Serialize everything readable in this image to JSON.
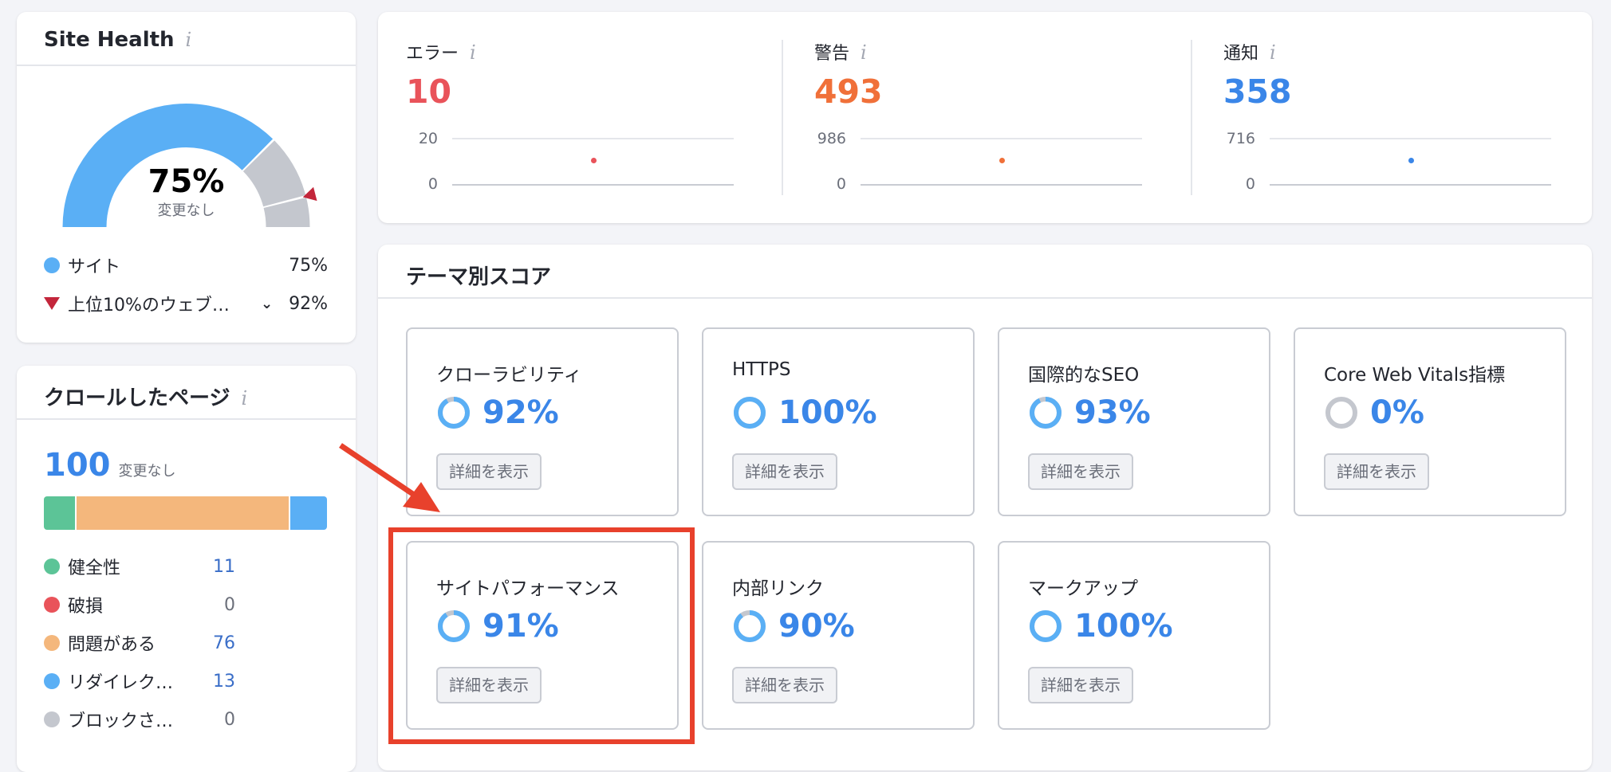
{
  "site_health": {
    "title": "Site Health",
    "value": "75%",
    "change": "変更なし",
    "gauge_percent": 75,
    "top10_percent": 92,
    "legend": [
      {
        "label": "サイト",
        "value": "75%",
        "color": "#5aaff5"
      },
      {
        "label": "上位10%のウェブ…",
        "value": "92%",
        "color": "#c3263b"
      }
    ]
  },
  "crawled": {
    "title": "クロールしたページ",
    "total": "100",
    "change": "変更なし",
    "items": [
      {
        "label": "健全性",
        "value": "11",
        "color": "#5cc497"
      },
      {
        "label": "破損",
        "value": "0",
        "color": "#e9535a"
      },
      {
        "label": "問題がある",
        "value": "76",
        "color": "#f4b77c"
      },
      {
        "label": "リダイレク…",
        "value": "13",
        "color": "#5aaff5"
      },
      {
        "label": "ブロックさ…",
        "value": "0",
        "color": "#c4c7ce"
      }
    ]
  },
  "issues": [
    {
      "label": "エラー",
      "value": "10",
      "color": "#e9535a",
      "max": "20",
      "min": "0"
    },
    {
      "label": "警告",
      "value": "493",
      "color": "#f07039",
      "max": "986",
      "min": "0"
    },
    {
      "label": "通知",
      "value": "358",
      "color": "#3a86e8",
      "max": "716",
      "min": "0"
    }
  ],
  "themes": {
    "title": "テーマ別スコア",
    "button_label": "詳細を表示",
    "tiles": [
      {
        "name": "クローラビリティ",
        "value": "92%",
        "percent": 92
      },
      {
        "name": "HTTPS",
        "value": "100%",
        "percent": 100
      },
      {
        "name": "国際的なSEO",
        "value": "93%",
        "percent": 93
      },
      {
        "name": "Core Web Vitals指標",
        "value": "0%",
        "percent": 0
      },
      {
        "name": "サイトパフォーマンス",
        "value": "91%",
        "percent": 91
      },
      {
        "name": "内部リンク",
        "value": "90%",
        "percent": 90
      },
      {
        "name": "マークアップ",
        "value": "100%",
        "percent": 100
      }
    ]
  },
  "annotation_color": "#e8412c"
}
